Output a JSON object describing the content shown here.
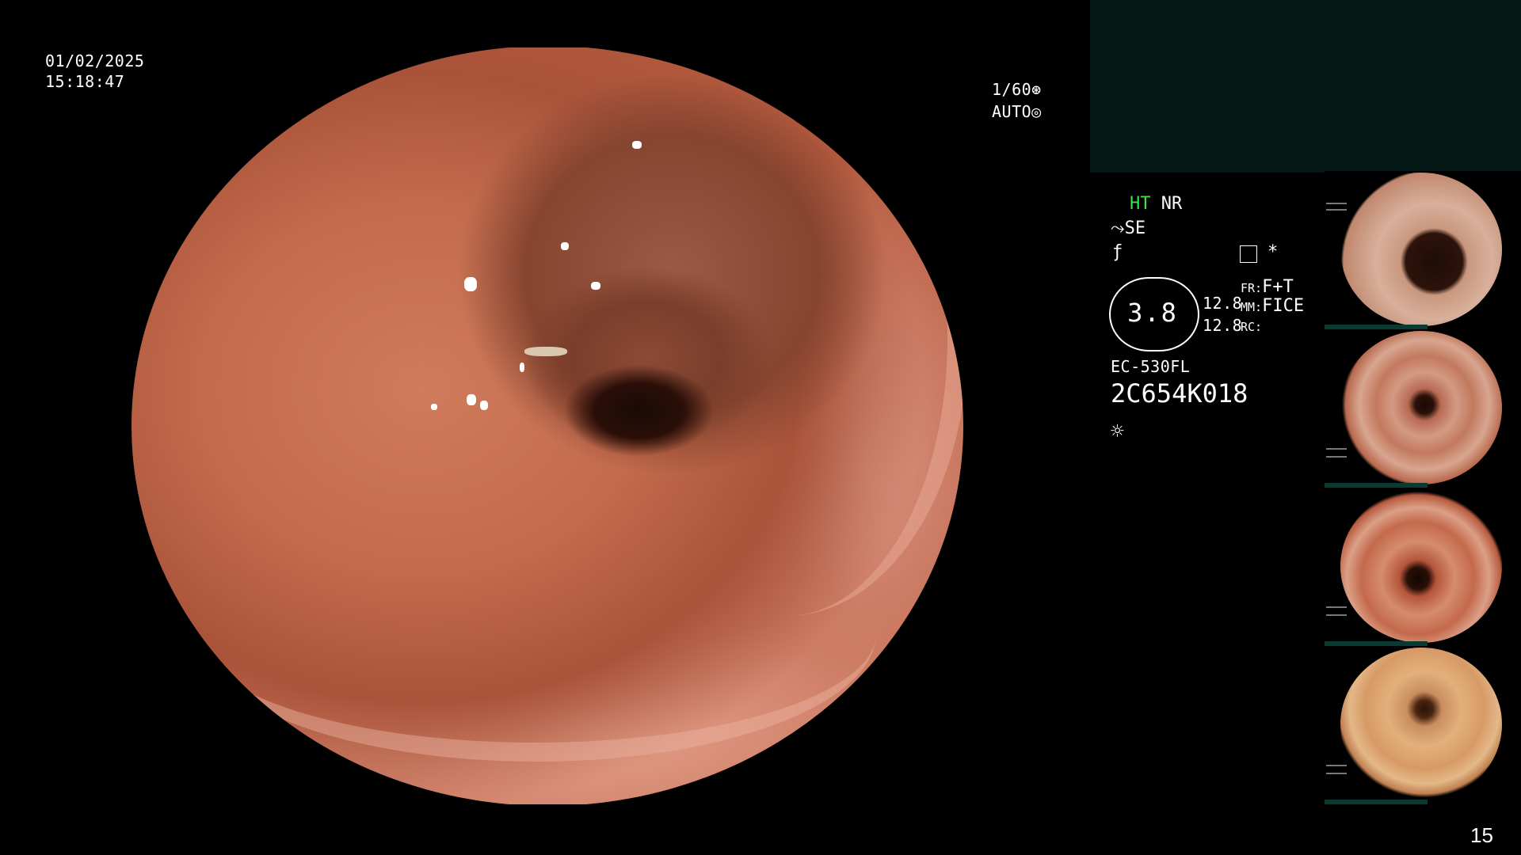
{
  "overlay": {
    "date": "01/02/2025",
    "time": "15:18:47",
    "shutter": "1/60",
    "exposure_mode": "AUTO"
  },
  "settings": {
    "ht_label": "HT",
    "nr_label": "NR",
    "se_label": "SE",
    "magnification": "3.8",
    "value_1": "12.8",
    "value_2": "12.8",
    "fr_label": "FR:",
    "fr_value": "F+T",
    "mm_label": "MM:",
    "mm_value": "FICE",
    "rc_label": "RC:",
    "scope_model": "EC-530FL",
    "serial": "2C654K018",
    "asterisk": "*"
  },
  "thumbnails": {
    "count": 4
  },
  "page_number": "15",
  "colors": {
    "accent_green": "#3fe04a",
    "panel": "#041815"
  },
  "icons": [
    "shutter-icon",
    "auto-exposure-icon",
    "se-icon",
    "structure-icon",
    "memory-icon",
    "brightness-icon"
  ]
}
